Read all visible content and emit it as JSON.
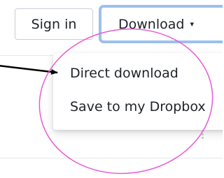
{
  "header": {
    "signin_label": "Sign in",
    "download_label": "Download",
    "download_caret": "▾"
  },
  "dropdown": {
    "items": [
      {
        "label": "Direct download"
      },
      {
        "label": "Save to my Dropbox"
      }
    ]
  },
  "annotation": {
    "circle_color": "#e85ad6",
    "arrow_color": "#000000"
  },
  "colors": {
    "download_border": "#9cc0e9",
    "text": "#1f2328"
  }
}
